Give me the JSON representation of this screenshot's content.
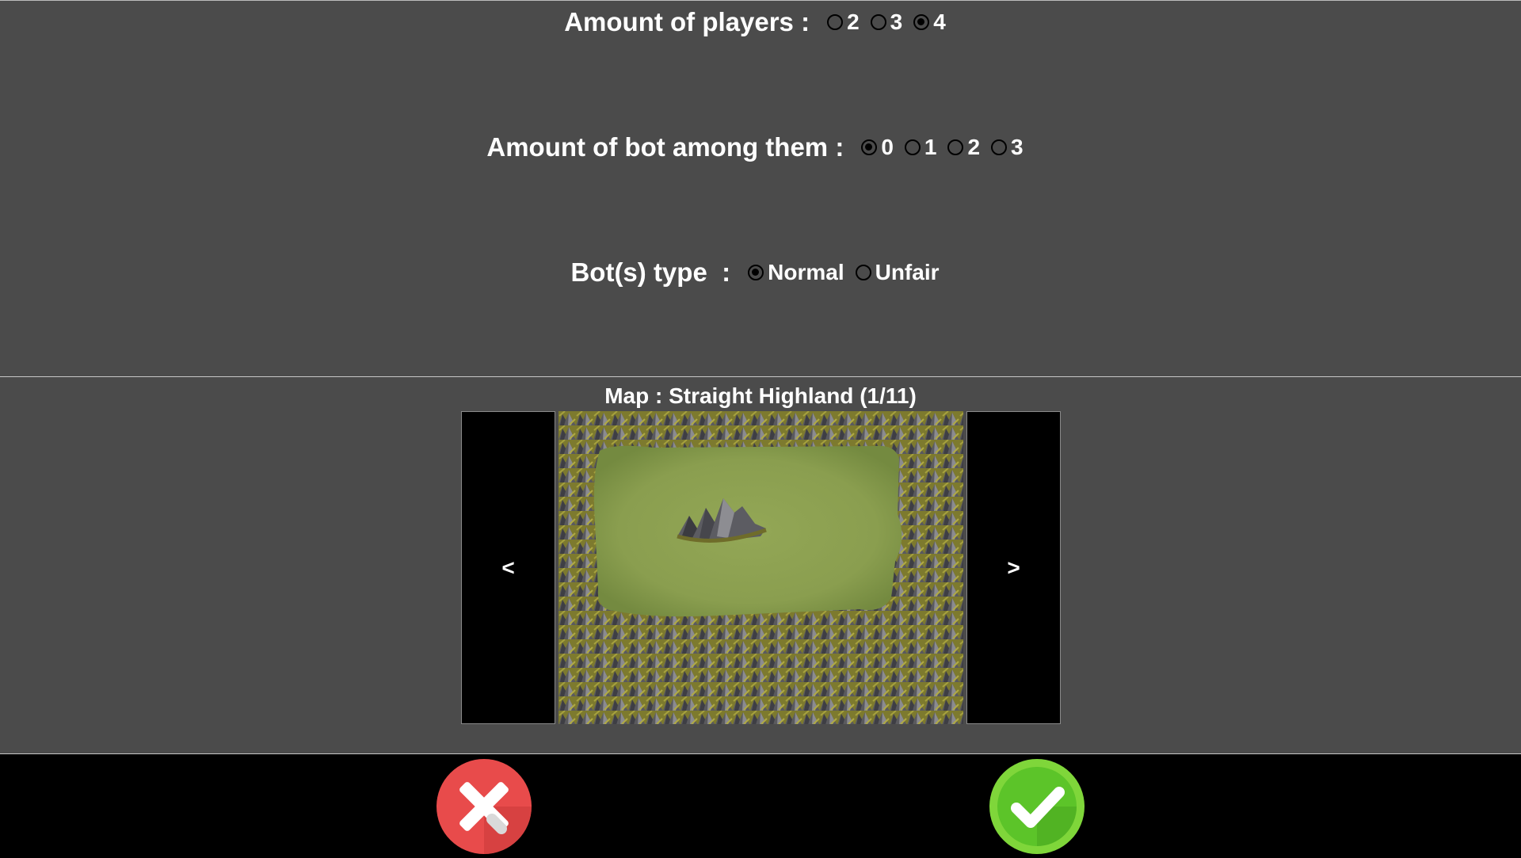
{
  "players": {
    "label": "Amount of players :",
    "options": [
      "2",
      "3",
      "4"
    ],
    "selected": "4"
  },
  "bots": {
    "label": "Amount of bot among them :",
    "options": [
      "0",
      "1",
      "2",
      "3"
    ],
    "selected": "0"
  },
  "bot_type": {
    "label": "Bot(s) type  :",
    "options": [
      "Normal",
      "Unfair"
    ],
    "selected": "Normal"
  },
  "map": {
    "title": "Map : Straight Highland (1/11)",
    "prev_label": "<",
    "next_label": ">",
    "preview_icon": "highland-map-preview"
  },
  "actions": {
    "cancel_icon": "red-cross-icon",
    "confirm_icon": "green-check-icon"
  },
  "colors": {
    "panel_background": "#4b4b4b",
    "cancel_red": "#e84b4b",
    "confirm_green": "#5cc429"
  }
}
